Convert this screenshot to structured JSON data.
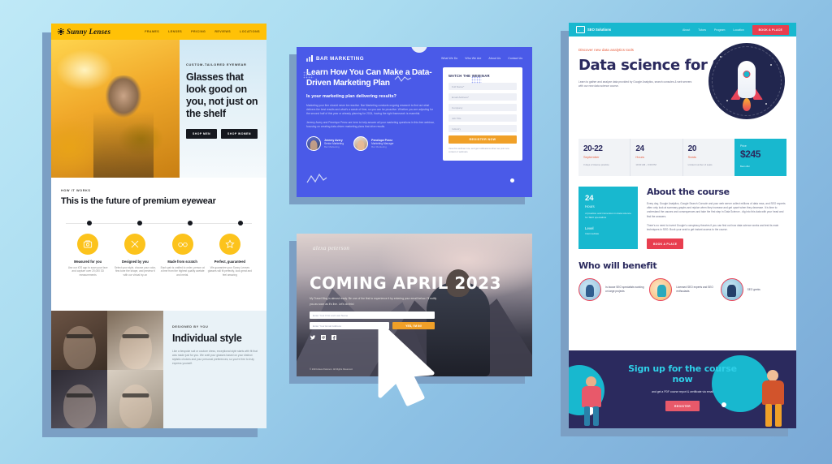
{
  "background": {
    "colors": [
      "#bfe9f7",
      "#aadcf0",
      "#8cc0e4",
      "#7aa9d6"
    ],
    "shadow_color": "#7b9fc4"
  },
  "sunny_lenses": {
    "brand": "Sunny Lenses",
    "nav": [
      "FRAMES",
      "LENSES",
      "PRICING",
      "REVIEWS",
      "LOCATIONS"
    ],
    "hero": {
      "eyebrow": "CUSTOM-TAILORED EYEWEAR",
      "title": "Glasses that look good on you, not just on the shelf",
      "buttons": [
        "SHOP MEN",
        "SHOP WOMEN"
      ]
    },
    "how": {
      "eyebrow": "HOW IT WORKS",
      "title": "This is the future of premium eyewear",
      "features": [
        {
          "icon": "measure-icon",
          "title": "Measured for you",
          "desc": "Use our iOS app to scan your face and capture over 20,000 3D measurements"
        },
        {
          "icon": "pencils-icon",
          "title": "Designed by you",
          "desc": "Select your style, choose your color, fine-tune the shape, and preview it with our virtual try-on"
        },
        {
          "icon": "glasses-icon",
          "title": "Made from scratch",
          "desc": "Each pair is crafted to order, person at a time from the highest quality acetate and metal."
        },
        {
          "icon": "star-icon",
          "title": "Perfect, guaranteed",
          "desc": "We guarantee your Sunny Lenses glasses will fit perfectly, look great and feel amazing"
        }
      ]
    },
    "style": {
      "eyebrow": "DESIGNED BY YOU",
      "title": "Individual style",
      "body": "Like a bespoke suit or couture dress, exceptional style starts with fit that was made just for you. We craft your glasses based on your distinct stylistic choices and your personal preferences, so you're free to truly express yourself."
    },
    "accent": "#ffc107"
  },
  "bar_marketing": {
    "brand": "BAR MARKETING",
    "nav": [
      "What We Do",
      "Who We Are",
      "About Us",
      "Contact Us"
    ],
    "headline": "Learn How You Can Make a Data-Driven Marketing Plan",
    "subhead": "Is your marketing plan delivering results?",
    "paragraph1": "Marketing your firm should never be reactive. Bar Marketing conducts ongoing research to find out what delivers the best results and what's a waste of time, so you can be proactive. Whether you are adjusting for the second half of this year or already planning for 2024, having the right framework is essential.",
    "paragraph2": "Jeremy Avery and Penelope Perez are here to help answer all your marketing questions in this free webinar, focusing on creating data-driven marketing plans that drive results.",
    "speakers": [
      {
        "name": "Jeremy Avery",
        "role": "Senior Marketing",
        "company": "Bar Marketing"
      },
      {
        "name": "Penelope Perez",
        "role": "Marketing Manager",
        "company": "Bar Marketing"
      }
    ],
    "form": {
      "title": "WATCH THE WEBINAR",
      "fields": [
        "Full Name*",
        "Email Address*",
        "Company",
        "Job Title",
        "Industry"
      ],
      "submit": "REGISTER NOW",
      "note": "View this webinar now, and get notifications when we post new content or webinars."
    },
    "accent": "#4a5ae8",
    "button_color": "#f0a028"
  },
  "alexa": {
    "logo": "alexa peterson",
    "headline": "COMING APRIL 2023",
    "paragraph": "My Travel Blog is almost ready. Be one of the first to experience it by entering your email below. I'll notify you as soon as it's live. Let's do this!",
    "inputs": [
      "Enter Your First and Last Name",
      "Enter Your Email Address"
    ],
    "button": "YES, I'M IN!",
    "social": [
      "twitter-icon",
      "instagram-icon",
      "facebook-icon"
    ],
    "copyright": "© 2023 Alexa Peterson. All Rights Reserved."
  },
  "seo": {
    "brand": "SEO Solutions",
    "nav": [
      "About",
      "Tutors",
      "Program",
      "Location"
    ],
    "nav_cta": "BOOK A PLACE",
    "hero": {
      "kicker": "Discover new data analytics tools",
      "title": "Data science for SEO",
      "sub": "Learn to gather and analyze data provided by Google Analytics, search consoles & web servers with our new data science course."
    },
    "stats": [
      {
        "num": "20-22",
        "label": "September",
        "desc": "3 days of intense practice"
      },
      {
        "num": "24",
        "label": "Hours",
        "desc": "10:00 AM – 6:00 PM"
      },
      {
        "num": "20",
        "label": "Seats",
        "desc": "Limited number of seats"
      }
    ],
    "price": {
      "label": "Price",
      "value": "$245",
      "desc": "Best offer"
    },
    "about": {
      "title": "About the course",
      "card": {
        "num": "24",
        "hours_label": "Hours",
        "desc": "of practice and immersion in data science for SEO specialists",
        "level_label": "Level",
        "level_value": "Intermediate"
      },
      "p1": "Every day, Google Analytics, Google Search Console and your web server collect millions of data rows, and SEO experts often only look at summary graphs and rejoice when they increase and get upset when they decrease. It is time to understand the causes and consequences and take the first step in Data Science - dig into this data with your head and find the answers.",
      "p2": "There's no need to invent Google's conspiracy theories if you can find out how data science works and test its main techniques in SEO. Book your seat to get instant access to the course.",
      "button": "BOOK A PLACE"
    },
    "benefit": {
      "title": "Who will benefit",
      "items": [
        {
          "icon": "specialist-icon",
          "text": "In-house SEO specialists working on large projects"
        },
        {
          "icon": "expert-icon",
          "text": "Licensed SEO experts and SEO enthusiasts"
        },
        {
          "icon": "geek-icon",
          "text": "SEO geeks"
        }
      ]
    },
    "signup": {
      "title": "Sign up for the course now",
      "sub": "and get a PDF course report & certificate via email",
      "button": "REGISTER"
    },
    "colors": {
      "teal": "#18b8cf",
      "red": "#e83e4f",
      "navy": "#2b2a5e",
      "orange": "#e85c3c"
    }
  },
  "cursor": {
    "name": "mouse-pointer"
  }
}
